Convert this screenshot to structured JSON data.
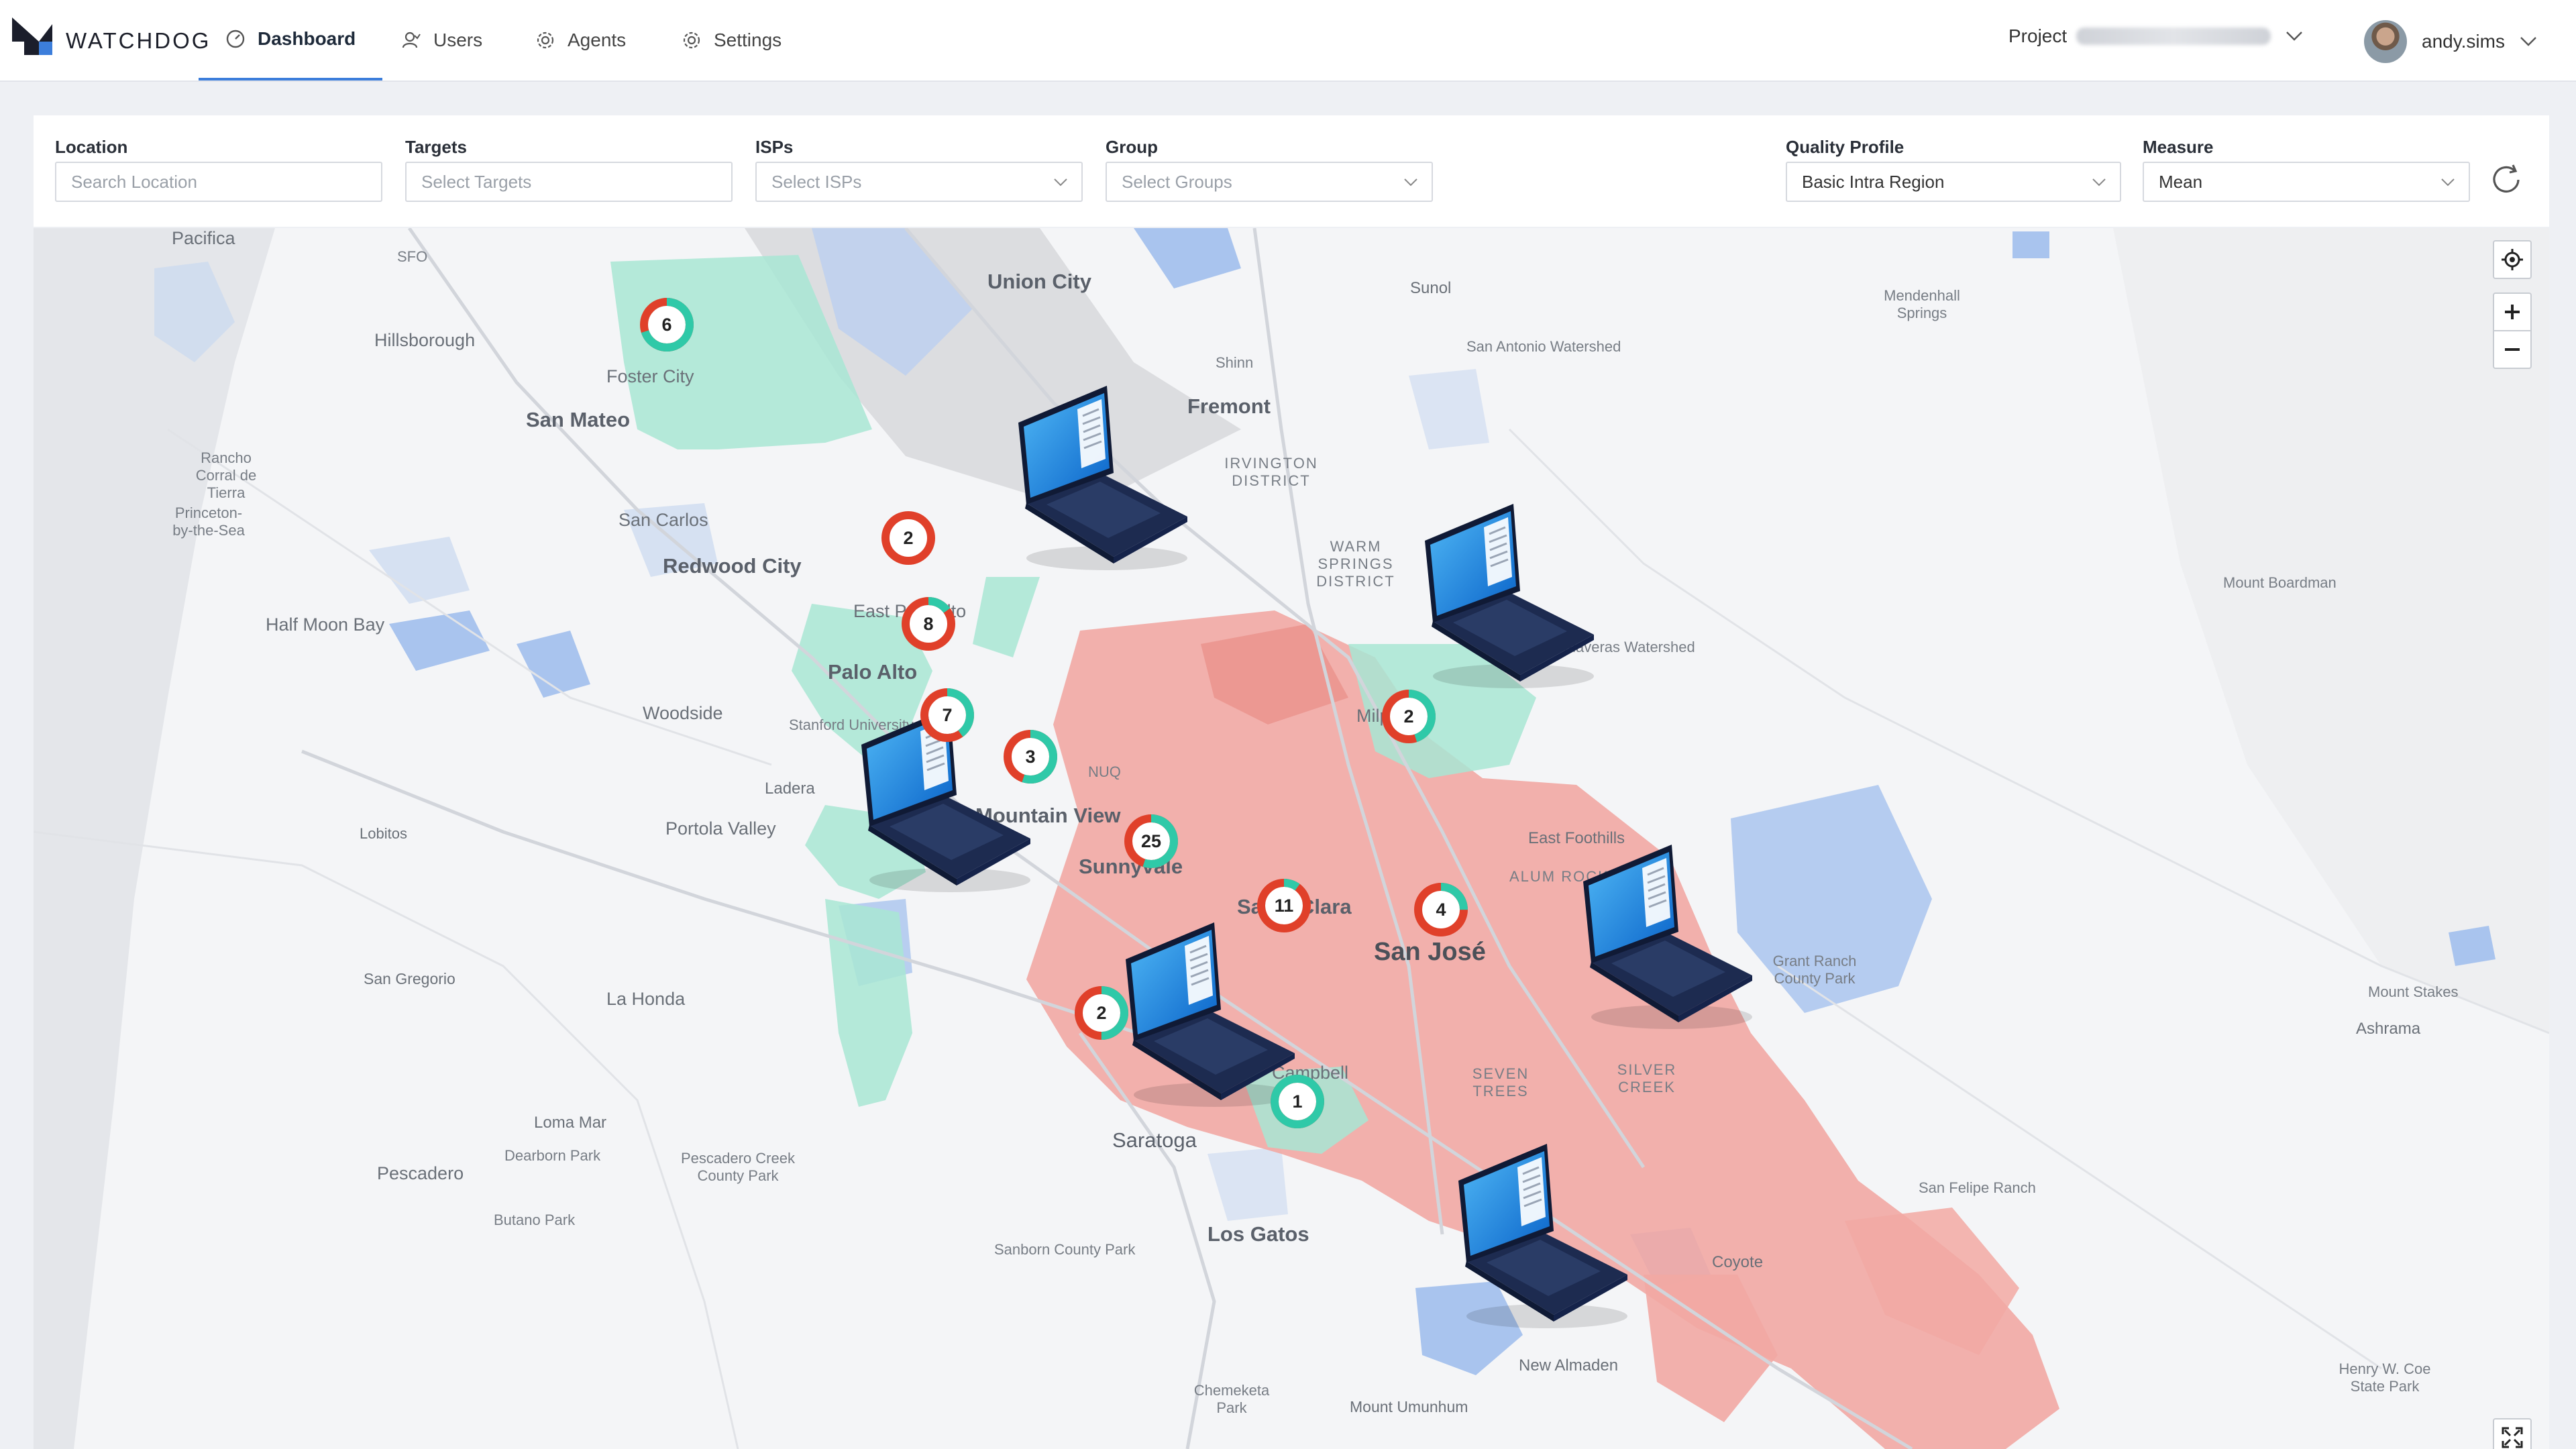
{
  "app": {
    "brand": "WATCHDOG"
  },
  "nav": {
    "tabs": [
      {
        "label": "Dashboard",
        "icon": "dashboard-gauge-icon",
        "active": true
      },
      {
        "label": "Users",
        "icon": "users-icon"
      },
      {
        "label": "Agents",
        "icon": "agents-gear-icon"
      },
      {
        "label": "Settings",
        "icon": "settings-gear-icon"
      }
    ]
  },
  "header": {
    "project_label": "Project",
    "username": "andy.sims"
  },
  "filters": {
    "location": {
      "label": "Location",
      "placeholder": "Search Location"
    },
    "targets": {
      "label": "Targets",
      "placeholder": "Select Targets"
    },
    "isps": {
      "label": "ISPs",
      "placeholder": "Select ISPs"
    },
    "group": {
      "label": "Group",
      "placeholder": "Select Groups"
    },
    "quality_profile": {
      "label": "Quality Profile",
      "value": "Basic Intra Region"
    },
    "measure": {
      "label": "Measure",
      "value": "Mean"
    }
  },
  "map": {
    "places": [
      "Pacifica",
      "SFO",
      "Hillsborough",
      "San Mateo",
      "Foster City",
      "Rancho Corral de Tierra",
      "Princeton-by-the-Sea",
      "San Carlos",
      "Redwood City",
      "Half Moon Bay",
      "Woodside",
      "Palo Alto",
      "Stanford University",
      "Ladera",
      "Portola Valley",
      "Lobitos",
      "San Gregorio",
      "La Honda",
      "Loma Mar",
      "Pescadero Creek County Park",
      "Dearborn Park",
      "Pescadero",
      "Butano Park",
      "Union City",
      "Fremont",
      "Shinn",
      "Irvington District",
      "Warm Springs District",
      "Sunol",
      "San Antonio Watershed",
      "Mendenhall Springs",
      "Calaveras Watershed",
      "Mount Boardman",
      "East Palo Alto",
      "Milpitas",
      "NUQ",
      "Mountain View",
      "Sunnyvale",
      "Santa Clara",
      "San José",
      "East Foothills",
      "Alum Rock",
      "Grant Ranch County Park",
      "Mount Stakes",
      "Ashrama",
      "Campbell",
      "Saratoga",
      "Seven Trees",
      "Silver Creek",
      "Los Gatos",
      "Sanborn County Park",
      "San Felipe Ranch",
      "Coyote",
      "New Almaden",
      "Chemeketa Park",
      "Mount Umunhum",
      "Henry W. Coe State Park"
    ],
    "clusters": [
      {
        "count": "6",
        "healthy_fraction": 0.7
      },
      {
        "count": "2",
        "healthy_fraction": 0.0
      },
      {
        "count": "8",
        "healthy_fraction": 0.15
      },
      {
        "count": "7",
        "healthy_fraction": 0.4
      },
      {
        "count": "3",
        "healthy_fraction": 0.55
      },
      {
        "count": "2",
        "healthy_fraction": 0.45
      },
      {
        "count": "25",
        "healthy_fraction": 0.55
      },
      {
        "count": "11",
        "healthy_fraction": 0.1
      },
      {
        "count": "4",
        "healthy_fraction": 0.25
      },
      {
        "count": "2",
        "healthy_fraction": 0.5
      },
      {
        "count": "1",
        "healthy_fraction": 1.0
      }
    ],
    "agents_visible": 6,
    "colors": {
      "healthy": "#2fc9a8",
      "unhealthy": "#e0402a",
      "region_good": "#a8e6d3",
      "region_bad": "#f2a9a3",
      "water": "#a9c4ee",
      "accent": "#3c7edb"
    }
  }
}
